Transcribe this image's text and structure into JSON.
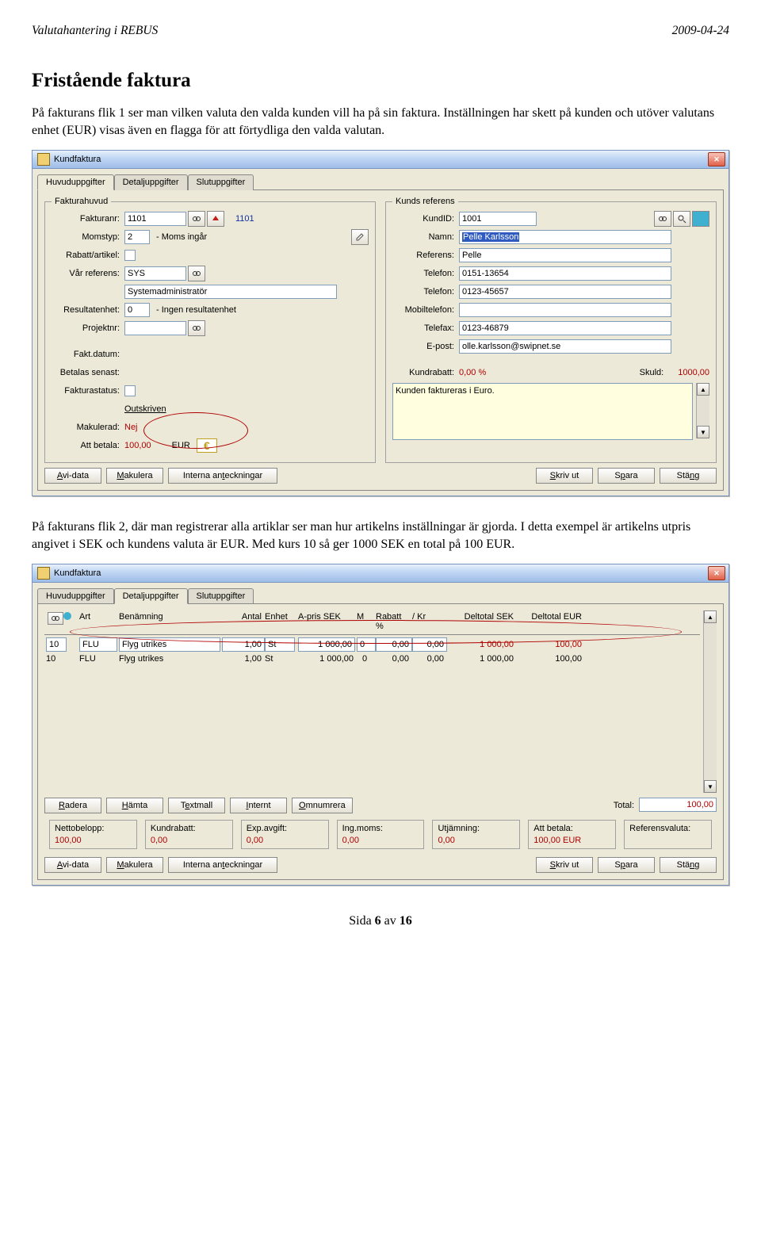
{
  "header": {
    "left": "Valutahantering i REBUS",
    "right": "2009-04-24"
  },
  "title": "Fristående faktura",
  "para1": "På fakturans flik 1 ser man vilken valuta den valda kunden vill ha på sin faktura. Inställningen har skett på kunden och utöver valutans enhet (EUR) visas även en flagga för att förtydliga den valda valutan.",
  "para2": "På fakturans flik 2, där man registrerar alla artiklar ser man hur artikelns inställningar är gjorda. I detta exempel är artikelns utpris angivet i SEK och kundens valuta är EUR. Med kurs 10 så ger 1000 SEK en total på 100 EUR.",
  "win": {
    "title": "Kundfaktura",
    "tabs": [
      "Huvuduppgifter",
      "Detaljuppgifter",
      "Slutuppgifter"
    ],
    "fakturahuvud": {
      "legend": "Fakturahuvud",
      "fakturanr_lbl": "Fakturanr:",
      "fakturanr": "1101",
      "fakturanr2": "1101",
      "momstyp_lbl": "Momstyp:",
      "momstyp": "2",
      "momstyp_txt": "- Moms ingår",
      "rabatt_lbl": "Rabatt/artikel:",
      "varref_lbl": "Vår referens:",
      "varref": "SYS",
      "varref_name": "Systemadministratör",
      "resultat_lbl": "Resultatenhet:",
      "resultat": "0",
      "resultat_txt": "- Ingen resultatenhet",
      "projektnr_lbl": "Projektnr:",
      "faktdatum_lbl": "Fakt.datum:",
      "betalas_lbl": "Betalas senast:",
      "status_lbl": "Fakturastatus:",
      "status_txt": "Outskriven",
      "makulerad_lbl": "Makulerad:",
      "makulerad": "Nej",
      "attbetala_lbl": "Att betala:",
      "attbetala": "100,00",
      "attbetala_cur": "EUR"
    },
    "kundref": {
      "legend": "Kunds referens",
      "kundid_lbl": "KundID:",
      "kundid": "1001",
      "namn_lbl": "Namn:",
      "namn": "Pelle Karlsson",
      "referens_lbl": "Referens:",
      "referens": "Pelle",
      "tel1_lbl": "Telefon:",
      "tel1": "0151-13654",
      "tel2_lbl": "Telefon:",
      "tel2": "0123-45657",
      "mobil_lbl": "Mobiltelefon:",
      "fax_lbl": "Telefax:",
      "fax": "0123-46879",
      "epost_lbl": "E-post:",
      "epost": "olle.karlsson@swipnet.se",
      "kundrabatt_lbl": "Kundrabatt:",
      "kundrabatt": "0,00 %",
      "skuld_lbl": "Skuld:",
      "skuld": "1000,00",
      "note": "Kunden faktureras i Euro."
    },
    "buttons": {
      "avi": "Avi-data",
      "mak": "Makulera",
      "int": "Interna anteckningar",
      "skriv": "Skriv ut",
      "spara": "Spara",
      "stang": "Stäng",
      "radera": "Radera",
      "hamta": "Hämta",
      "textmall": "Textmall",
      "internt": "Internt",
      "omnum": "Omnumrera",
      "total_lbl": "Total:",
      "total": "100,00"
    },
    "cols": {
      "art": "Art",
      "ben": "Benämning",
      "antal": "Antal",
      "enhet": "Enhet",
      "apris": "A-pris SEK",
      "m": "M",
      "rabp": "Rabatt %",
      "rabkr": "/ Kr",
      "dt_sek": "Deltotal SEK",
      "dt_eur": "Deltotal EUR"
    },
    "rows": [
      {
        "id": "10",
        "art": "FLU",
        "ben": "Flyg utrikes",
        "antal": "1,00",
        "enhet": "St",
        "apris": "1 000,00",
        "m": "0",
        "rabp": "0,00",
        "rabkr": "0,00",
        "dtsek": "1 000,00",
        "dteur": "100,00"
      },
      {
        "id": "10",
        "art": "FLU",
        "ben": "Flyg utrikes",
        "antal": "1,00",
        "enhet": "St",
        "apris": "1 000,00",
        "m": "0",
        "rabp": "0,00",
        "rabkr": "0,00",
        "dtsek": "1 000,00",
        "dteur": "100,00"
      }
    ],
    "summary": {
      "netto_lbl": "Nettobelopp:",
      "netto": "100,00",
      "kundrab_lbl": "Kundrabatt:",
      "kundrab": "0,00",
      "exp_lbl": "Exp.avgift:",
      "exp": "0,00",
      "ingmoms_lbl": "Ing.moms:",
      "ingmoms": "0,00",
      "utj_lbl": "Utjämning:",
      "utj": "0,00",
      "attbet_lbl": "Att betala:",
      "attbet": "100,00 EUR",
      "refval_lbl": "Referensvaluta:",
      "refval": ""
    }
  },
  "footer": {
    "prefix": "Sida ",
    "page": "6",
    "mid": " av ",
    "total": "16"
  }
}
